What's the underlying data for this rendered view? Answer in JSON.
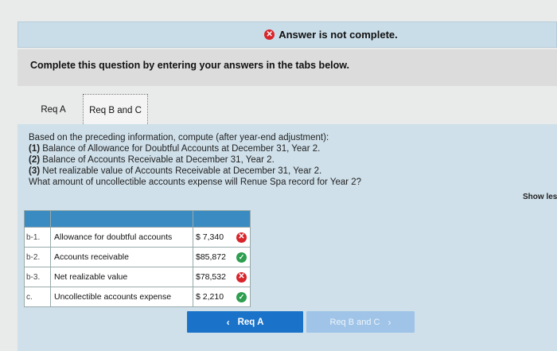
{
  "banner": {
    "text": "Answer is not complete."
  },
  "instruction": "Complete this question by entering your answers in the tabs below.",
  "tabs": [
    {
      "label": "Req A"
    },
    {
      "label": "Req B and C"
    }
  ],
  "question": {
    "intro": "Based on the preceding information, compute (after year-end adjustment):",
    "items": [
      {
        "num": "(1)",
        "text": " Balance of Allowance for Doubtful Accounts at December 31, Year 2."
      },
      {
        "num": "(2)",
        "text": " Balance of Accounts Receivable at December 31, Year 2."
      },
      {
        "num": "(3)",
        "text": " Net realizable value of Accounts Receivable at December 31, Year 2."
      }
    ],
    "final": "What amount of uncollectible accounts expense will Renue Spa record for Year 2?"
  },
  "show_less": "Show les",
  "rows": [
    {
      "label": "b-1.",
      "desc": "Allowance for doubtful accounts",
      "value": "$ 7,340",
      "status": "incorrect"
    },
    {
      "label": "b-2.",
      "desc": "Accounts receivable",
      "value": "$85,872",
      "status": "correct"
    },
    {
      "label": "b-3.",
      "desc": "Net realizable value",
      "value": "$78,532",
      "status": "incorrect"
    },
    {
      "label": "c.",
      "desc": "Uncollectible accounts expense",
      "value": "$ 2,210",
      "status": "correct"
    }
  ],
  "nav": {
    "prev_label": "Req A",
    "next_label": "Req B and C"
  },
  "colors": {
    "incorrect": "#d8252b",
    "correct": "#2e9e4f",
    "primary_button": "#1a73c9"
  }
}
